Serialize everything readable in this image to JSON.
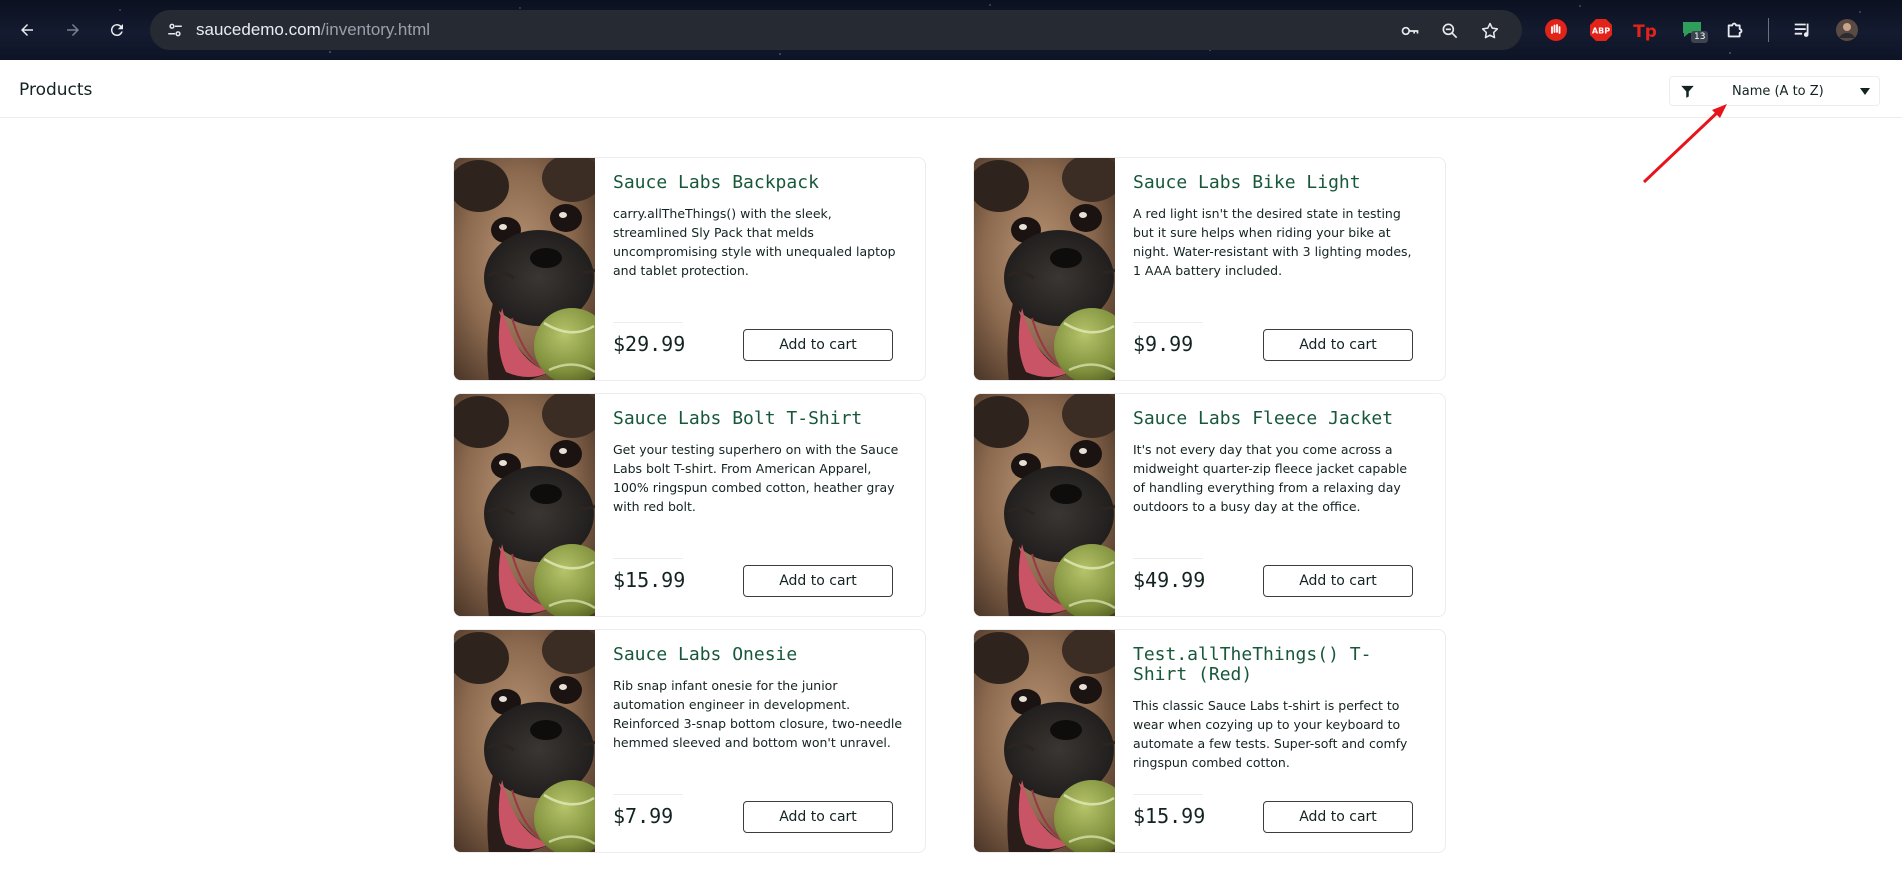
{
  "browser": {
    "url_host": "saucedemo.com",
    "url_path": "/inventory.html",
    "extension_badge": "13",
    "icons": [
      "back-icon",
      "forward-icon",
      "reload-icon",
      "site-info-icon",
      "password-key-icon",
      "zoom-icon",
      "bookmark-star-icon",
      "stop-hand-extension-icon",
      "adblock-extension-icon",
      "tp-extension-icon",
      "chat-extension-icon",
      "extensions-puzzle-icon",
      "media-queue-icon",
      "profile-avatar-icon"
    ]
  },
  "header": {
    "title": "Products"
  },
  "sort": {
    "selected": "Name (A to Z)"
  },
  "products": [
    {
      "name": "Sauce Labs Backpack",
      "description": "carry.allTheThings() with the sleek, streamlined Sly Pack that melds uncompromising style with unequaled laptop and tablet protection.",
      "price": "$29.99",
      "button": "Add to cart"
    },
    {
      "name": "Sauce Labs Bike Light",
      "description": "A red light isn't the desired state in testing but it sure helps when riding your bike at night. Water-resistant with 3 lighting modes, 1 AAA battery included.",
      "price": "$9.99",
      "button": "Add to cart"
    },
    {
      "name": "Sauce Labs Bolt T-Shirt",
      "description": "Get your testing superhero on with the Sauce Labs bolt T-shirt. From American Apparel, 100% ringspun combed cotton, heather gray with red bolt.",
      "price": "$15.99",
      "button": "Add to cart"
    },
    {
      "name": "Sauce Labs Fleece Jacket",
      "description": "It's not every day that you come across a midweight quarter-zip fleece jacket capable of handling everything from a relaxing day outdoors to a busy day at the office.",
      "price": "$49.99",
      "button": "Add to cart"
    },
    {
      "name": "Sauce Labs Onesie",
      "description": "Rib snap infant onesie for the junior automation engineer in development. Reinforced 3-snap bottom closure, two-needle hemmed sleeved and bottom won't unravel.",
      "price": "$7.99",
      "button": "Add to cart"
    },
    {
      "name": "Test.allTheThings() T-Shirt (Red)",
      "description": "This classic Sauce Labs t-shirt is perfect to wear when cozying up to your keyboard to automate a few tests. Super-soft and comfy ringspun combed cotton.",
      "price": "$15.99",
      "button": "Add to cart"
    }
  ],
  "colors": {
    "product_name": "#18583a",
    "annotation_arrow": "#e8141c"
  }
}
